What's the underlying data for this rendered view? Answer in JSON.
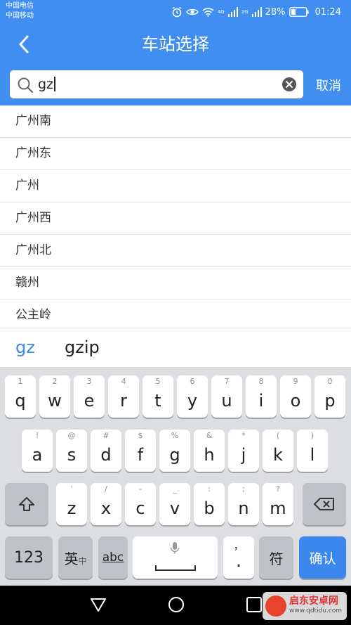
{
  "status_bar": {
    "carrier_1": "中国电信",
    "carrier_2": "中国移动",
    "network_badge_1": "4G",
    "network_badge_2": "2G",
    "battery_percent": "28%",
    "time": "01:24"
  },
  "header": {
    "title": "车站选择"
  },
  "search": {
    "query": "gz",
    "cancel_label": "取消"
  },
  "stations": [
    "广州南",
    "广州东",
    "广州",
    "广州西",
    "广州北",
    "赣州",
    "公主岭"
  ],
  "suggestions": [
    "gz",
    "gzip"
  ],
  "keyboard": {
    "row1": [
      {
        "hint": "1",
        "main": "q"
      },
      {
        "hint": "2",
        "main": "w"
      },
      {
        "hint": "3",
        "main": "e"
      },
      {
        "hint": "4",
        "main": "r"
      },
      {
        "hint": "5",
        "main": "t"
      },
      {
        "hint": "6",
        "main": "y"
      },
      {
        "hint": "7",
        "main": "u"
      },
      {
        "hint": "8",
        "main": "i"
      },
      {
        "hint": "9",
        "main": "o"
      },
      {
        "hint": "0",
        "main": "p"
      }
    ],
    "row2": [
      {
        "hint": "!",
        "main": "a"
      },
      {
        "hint": "@",
        "main": "s"
      },
      {
        "hint": "#",
        "main": "d"
      },
      {
        "hint": "$",
        "main": "f"
      },
      {
        "hint": "%",
        "main": "g"
      },
      {
        "hint": "&",
        "main": "h"
      },
      {
        "hint": "*",
        "main": "j"
      },
      {
        "hint": "(",
        "main": "k"
      },
      {
        "hint": ")",
        "main": "l"
      }
    ],
    "row3": [
      {
        "hint": "'",
        "main": "z"
      },
      {
        "hint": "/",
        "main": "x"
      },
      {
        "hint": "-",
        "main": "c"
      },
      {
        "hint": "_",
        "main": "v"
      },
      {
        "hint": ":",
        "main": "b"
      },
      {
        "hint": ";",
        "main": "n"
      },
      {
        "hint": "?",
        "main": "m"
      }
    ],
    "numbers_label": "123",
    "lang_label": "英",
    "lang_sub": "中",
    "abc_label": "abc",
    "comma_label": "，",
    "period_label": ".",
    "symbol_label": "符",
    "confirm_label": "确认"
  },
  "watermark": {
    "name": "启东安卓网",
    "url": "www.qdtidu.com"
  },
  "colors": {
    "accent": "#3f8ef0",
    "confirm_key": "#3a88ee"
  }
}
